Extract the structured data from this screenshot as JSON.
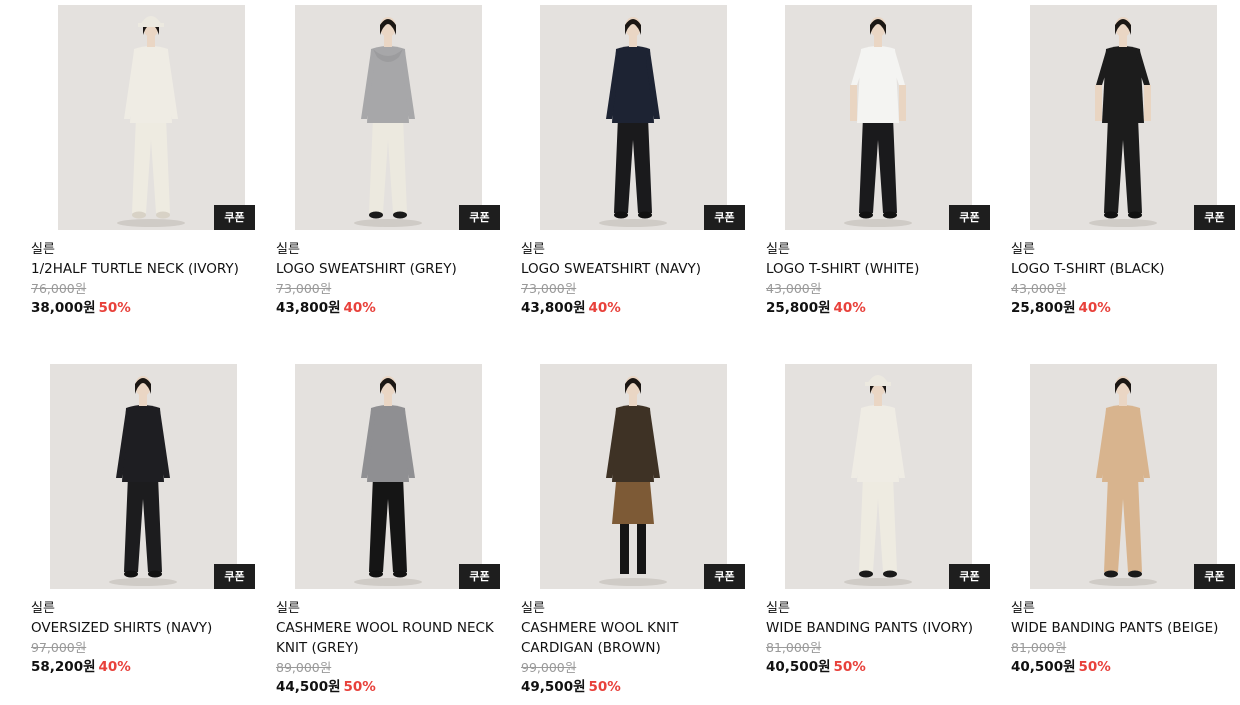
{
  "coupon_label": "쿠폰",
  "colors": {
    "discount": "#e8413b",
    "coupon_bg": "#1e1e1e",
    "photo_bg": "#e3e0dd"
  },
  "products": [
    {
      "brand": "실른",
      "name": "1/2HALF TURTLE NECK (IVORY)",
      "original_price": "76,000원",
      "sale_price": "38,000원",
      "discount": "50%",
      "image": "model-ivory-turtleneck-bucket-hat"
    },
    {
      "brand": "실른",
      "name": "LOGO SWEATSHIRT (GREY)",
      "original_price": "73,000원",
      "sale_price": "43,800원",
      "discount": "40%",
      "image": "model-grey-sweatshirt"
    },
    {
      "brand": "실른",
      "name": "LOGO SWEATSHIRT (NAVY)",
      "original_price": "73,000원",
      "sale_price": "43,800원",
      "discount": "40%",
      "image": "model-navy-sweatshirt"
    },
    {
      "brand": "실른",
      "name": "LOGO T-SHIRT (WHITE)",
      "original_price": "43,000원",
      "sale_price": "25,800원",
      "discount": "40%",
      "image": "model-white-tshirt"
    },
    {
      "brand": "실른",
      "name": "LOGO T-SHIRT (BLACK)",
      "original_price": "43,000원",
      "sale_price": "25,800원",
      "discount": "40%",
      "image": "model-black-tshirt"
    },
    {
      "brand": "실른",
      "name": "OVERSIZED SHIRTS (NAVY)",
      "original_price": "97,000원",
      "sale_price": "58,200원",
      "discount": "40%",
      "image": "model-navy-shirt"
    },
    {
      "brand": "실른",
      "name": "CASHMERE WOOL ROUND NECK KNIT (GREY)",
      "original_price": "89,000원",
      "sale_price": "44,500원",
      "discount": "50%",
      "image": "model-grey-knit"
    },
    {
      "brand": "실른",
      "name": "CASHMERE WOOL KNIT CARDIGAN (BROWN)",
      "original_price": "99,000원",
      "sale_price": "49,500원",
      "discount": "50%",
      "image": "model-brown-cardigan"
    },
    {
      "brand": "실른",
      "name": "WIDE BANDING PANTS (IVORY)",
      "original_price": "81,000원",
      "sale_price": "40,500원",
      "discount": "50%",
      "image": "model-ivory-pants-bucket-hat"
    },
    {
      "brand": "실른",
      "name": "WIDE BANDING PANTS (BEIGE)",
      "original_price": "81,000원",
      "sale_price": "40,500원",
      "discount": "50%",
      "image": "model-beige-knit-set"
    }
  ]
}
